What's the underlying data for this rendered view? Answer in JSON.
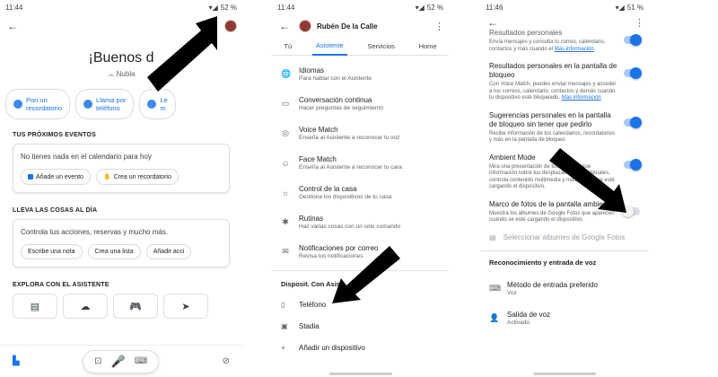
{
  "screen1": {
    "status_time": "11:44",
    "status_battery": "52 %",
    "greeting": "¡Buenos d",
    "subtitle": "Nubla",
    "chips": [
      {
        "label_line1": "Pon un",
        "label_line2": "recordatorio"
      },
      {
        "label_line1": "Llama por",
        "label_line2": "teléfono"
      },
      {
        "label_line1": "Le",
        "label_line2": "m"
      }
    ],
    "section_events": "TUS PRÓXIMOS EVENTOS",
    "events_text": "No tienes nada en el calendario para hoy",
    "events_buttons": [
      "Añade un evento",
      "Crea un recordatorio"
    ],
    "section_carry": "LLEVA LAS COSAS AL DÍA",
    "carry_text": "Controla tus acciones, reservas y mucho más.",
    "carry_buttons": [
      "Escribe una nota",
      "Crea una lista",
      "Añadir acci"
    ],
    "section_explore": "EXPLORA CON EL ASISTENTE",
    "explore_icons": [
      "▤",
      "☁",
      "🎮",
      "➤"
    ]
  },
  "screen2": {
    "status_time": "11:44",
    "status_battery": "52 %",
    "profile_name": "Rubén De la Calle",
    "tabs": [
      "Tú",
      "Asistente",
      "Servicios",
      "Home"
    ],
    "items": [
      {
        "title": "Idiomas",
        "subtitle": "Para hablar con el Asistente",
        "icon": "🌐"
      },
      {
        "title": "Conversación continua",
        "subtitle": "Hacer preguntas de seguimiento",
        "icon": "▭"
      },
      {
        "title": "Voice Match",
        "subtitle": "Enseña al Asistente a reconocer tu voz",
        "icon": "◎"
      },
      {
        "title": "Face Match",
        "subtitle": "Enseña al Asistente a reconocer tu cara",
        "icon": "☺"
      },
      {
        "title": "Control de la casa",
        "subtitle": "Gestiona los dispositivos de tu casa",
        "icon": "☼"
      },
      {
        "title": "Rutinas",
        "subtitle": "Haz varias cosas con un solo comando",
        "icon": "✱"
      },
      {
        "title": "Notificaciones por correo",
        "subtitle": "Revisa tus notificaciones",
        "icon": "✉"
      }
    ],
    "devices_header": "Disposit. Con Asis",
    "devices": [
      {
        "label": "Teléfono",
        "icon": "▯"
      },
      {
        "label": "Stadia",
        "icon": "▣"
      },
      {
        "label": "Añadir un dispositivo",
        "icon": "+"
      }
    ]
  },
  "screen3": {
    "status_time": "11:46",
    "status_battery": "51 %",
    "settings": [
      {
        "title": "Resultados personales",
        "subtitle": "Envía mensajes y consulta tu correo, calendario, contactos y más cuando el ",
        "link": "Más información",
        "on": true
      },
      {
        "title": "Resultados personales en la pantalla de bloqueo",
        "subtitle": "Con Voice Match, puedes enviar mensajes y acceder a tus correos, calendario, contactos y demás cuando tu dispositivo esté bloqueado. ",
        "link": "Más información",
        "on": true
      },
      {
        "title": "Sugerencias personales en la pantalla de bloqueo sin tener que pedirlo",
        "subtitle": "Recibe información de tus calendarios, recordatorios y más en la pantalla de bloqueo",
        "link": "",
        "on": true
      },
      {
        "title": "Ambient Mode",
        "subtitle": "Mira una presentación de tus fotos o sigue información sobre tus desplazamientos habituales, controla contenido multimedia y más cuando se esté cargando el dispositivo.",
        "link": "",
        "on": true
      },
      {
        "title": "Marco de fotos de la pantalla ambiente",
        "subtitle": "Muestra los álbumes de Google Fotos que aparecen cuando se esté cargando el dispositivo.",
        "link": "",
        "on": false
      }
    ],
    "select_albums": "Seleccionar álbumes de Google Fotos",
    "voice_header": "Reconocimiento y entrada de voz",
    "voice_items": [
      {
        "title": "Método de entrada preferido",
        "subtitle": "Voz",
        "icon": "⌨"
      },
      {
        "title": "Salida de voz",
        "subtitle": "Activado",
        "icon": "👤"
      }
    ]
  },
  "colors": {
    "accent": "#1a73e8",
    "arrow": "#000000"
  }
}
